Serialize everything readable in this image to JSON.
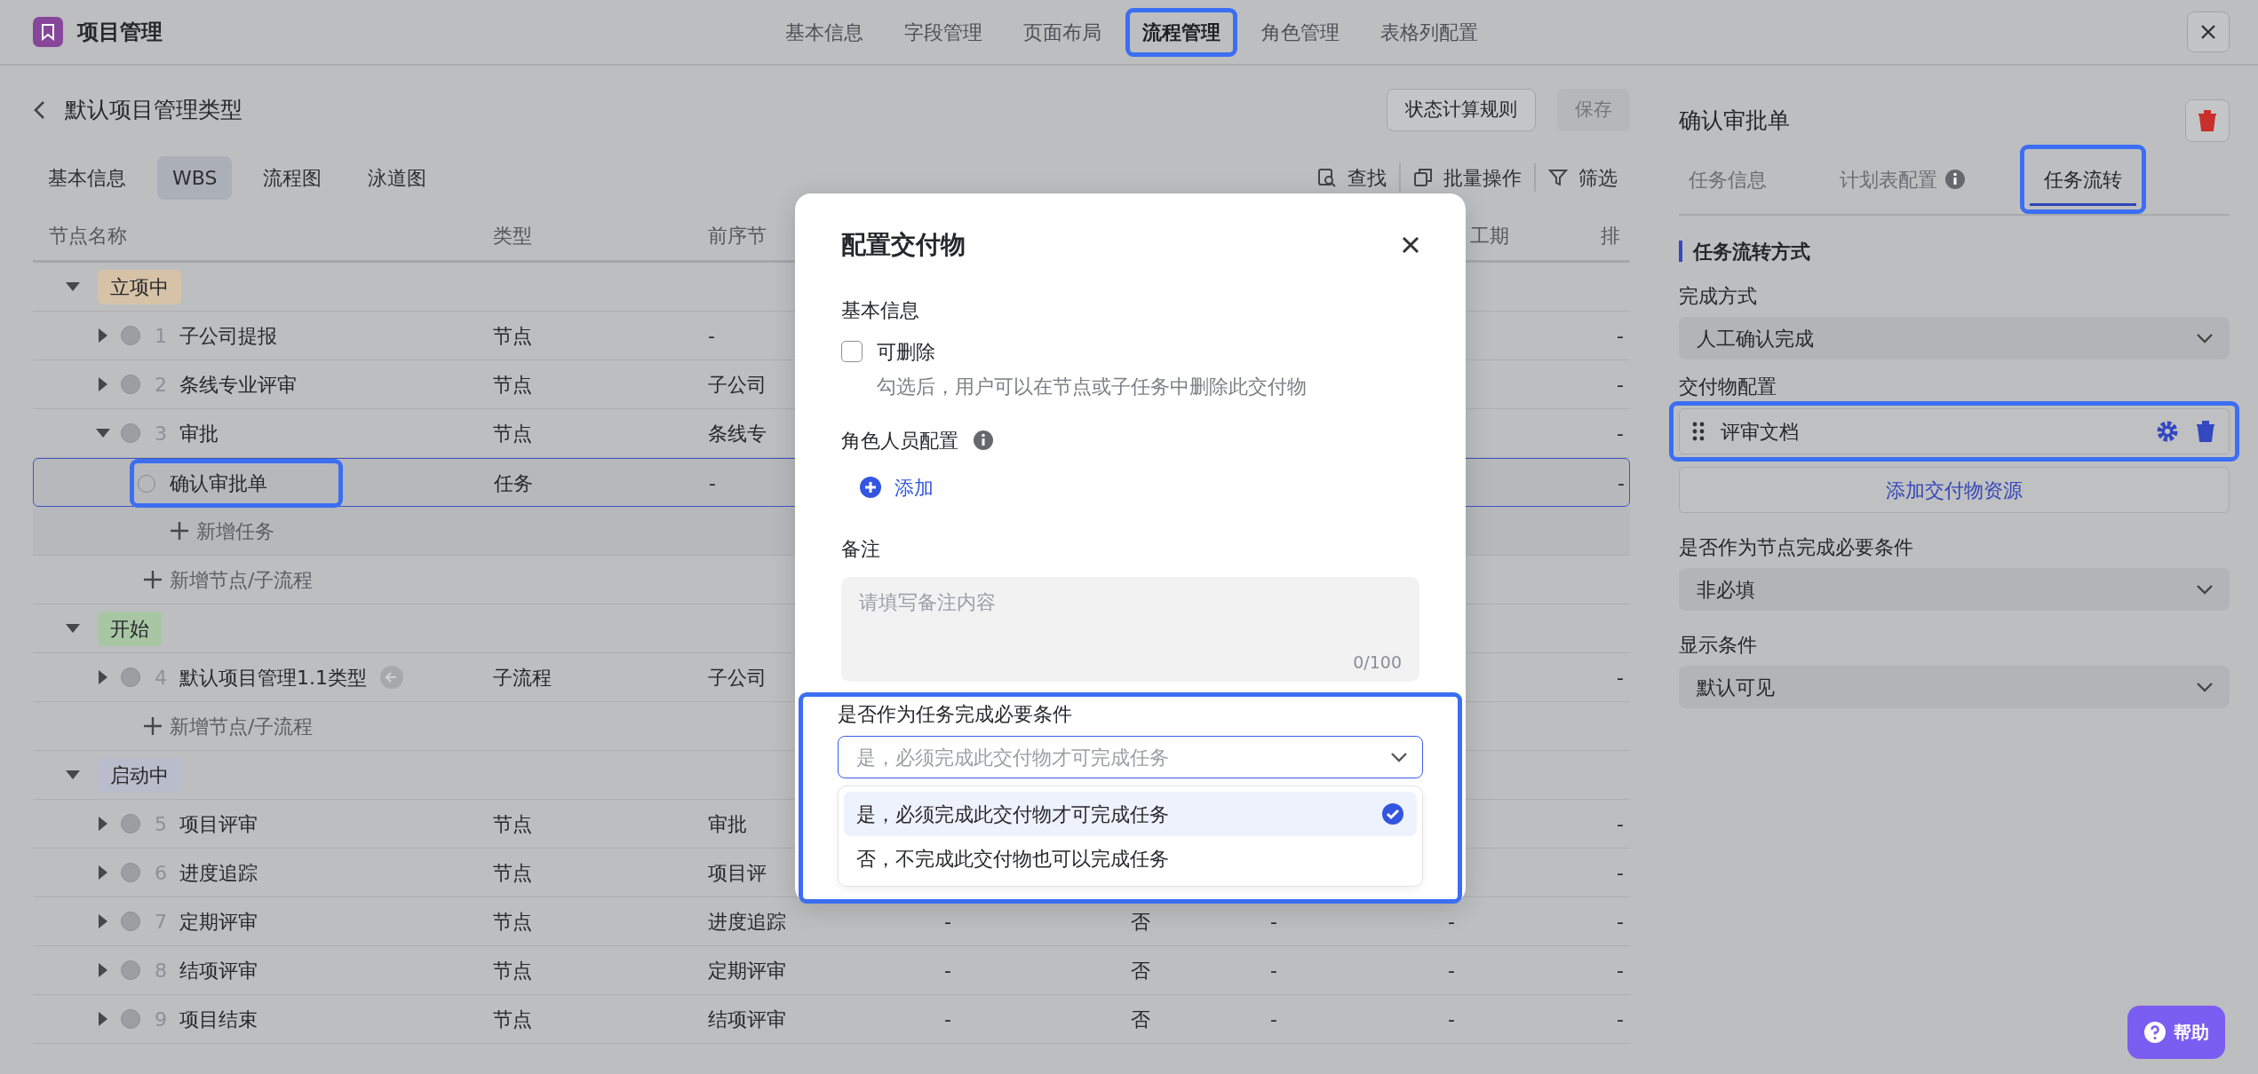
{
  "app": {
    "title": "项目管理"
  },
  "top_tabs": [
    {
      "label": "基本信息",
      "selected": false,
      "highlighted": false
    },
    {
      "label": "字段管理",
      "selected": false,
      "highlighted": false
    },
    {
      "label": "页面布局",
      "selected": false,
      "highlighted": false
    },
    {
      "label": "流程管理",
      "selected": true,
      "highlighted": true
    },
    {
      "label": "角色管理",
      "selected": false,
      "highlighted": false
    },
    {
      "label": "表格列配置",
      "selected": false,
      "highlighted": false
    }
  ],
  "page": {
    "title": "默认项目管理类型",
    "buttons": [
      {
        "label": "状态计算规则",
        "disabled": false
      },
      {
        "label": "保存",
        "disabled": true
      }
    ]
  },
  "view_tabs": [
    {
      "label": "基本信息",
      "selected": false
    },
    {
      "label": "WBS",
      "selected": true
    },
    {
      "label": "流程图",
      "selected": false
    },
    {
      "label": "泳道图",
      "selected": false
    }
  ],
  "toolbar": [
    {
      "kind": "search",
      "label": "查找"
    },
    {
      "kind": "batch",
      "label": "批量操作"
    },
    {
      "kind": "filter",
      "label": "筛选"
    }
  ],
  "table": {
    "columns": {
      "name": "节点名称",
      "type": "类型",
      "predecessor": "前序节",
      "column_7": "工期",
      "column_8": "排"
    },
    "groups": [
      {
        "label": "立项中",
        "color": "#d6c3a7",
        "expanded": true,
        "add_label": "新增节点/子流程",
        "rows": [
          {
            "kind": "node",
            "number": "1",
            "name": "子公司提报",
            "expanded": false,
            "selected": false,
            "type": "节点",
            "predecessor": "-",
            "column_8": "-"
          },
          {
            "kind": "node",
            "number": "2",
            "name": "条线专业评审",
            "expanded": false,
            "selected": false,
            "type": "节点",
            "predecessor": "子公司",
            "column_8": "-"
          },
          {
            "kind": "node",
            "number": "3",
            "name": "审批",
            "expanded": true,
            "selected": false,
            "type": "节点",
            "predecessor": "条线专",
            "column_8": "-",
            "add_label": "新增任务",
            "children": [
              {
                "kind": "task",
                "name": "确认审批单",
                "selected": true,
                "highlighted": true,
                "type": "任务",
                "predecessor": "-",
                "column_8": "-"
              }
            ]
          }
        ]
      },
      {
        "label": "开始",
        "color": "#a8c6a4",
        "expanded": true,
        "add_label": "新增节点/子流程",
        "rows": [
          {
            "kind": "subflow",
            "number": "4",
            "name": "默认项目管理1.1类型",
            "expanded": false,
            "selected": false,
            "type": "子流程",
            "predecessor": "子公司",
            "column_8": "-"
          }
        ]
      },
      {
        "label": "启动中",
        "color": "#b8bccb",
        "expanded": true,
        "rows": [
          {
            "kind": "node",
            "number": "5",
            "name": "项目评审",
            "expanded": false,
            "selected": false,
            "type": "节点",
            "predecessor": "审批",
            "column_8": "-"
          },
          {
            "kind": "node",
            "number": "6",
            "name": "进度追踪",
            "expanded": false,
            "selected": false,
            "type": "节点",
            "predecessor": "项目评",
            "column_8": "-"
          },
          {
            "kind": "node",
            "number": "7",
            "name": "定期评审",
            "expanded": false,
            "selected": false,
            "type": "节点",
            "predecessor": "进度追踪",
            "column_4": "-",
            "column_5": "否",
            "column_6": "-",
            "column_7": "-",
            "column_8": "-"
          },
          {
            "kind": "node",
            "number": "8",
            "name": "结项评审",
            "expanded": false,
            "selected": false,
            "type": "节点",
            "predecessor": "定期评审",
            "column_4": "-",
            "column_5": "否",
            "column_6": "-",
            "column_7": "-",
            "column_8": "-"
          },
          {
            "kind": "node",
            "number": "9",
            "name": "项目结束",
            "expanded": false,
            "selected": false,
            "type": "节点",
            "predecessor": "结项评审",
            "column_4": "-",
            "column_5": "否",
            "column_6": "-",
            "column_7": "-",
            "column_8": "-"
          }
        ]
      }
    ]
  },
  "detail": {
    "title": "确认审批单",
    "tabs": [
      {
        "label": "任务信息",
        "selected": false,
        "info": false,
        "highlighted": false
      },
      {
        "label": "计划表配置",
        "selected": false,
        "info": true,
        "highlighted": false
      },
      {
        "label": "任务流转",
        "selected": true,
        "info": false,
        "highlighted": true
      }
    ],
    "section_title": "任务流转方式",
    "fields": [
      {
        "kind": "select",
        "label": "完成方式",
        "value": "人工确认完成"
      },
      {
        "kind": "deliverables",
        "label": "交付物配置",
        "items": [
          {
            "name": "评审文档",
            "highlighted": true
          }
        ],
        "add_button": "添加交付物资源"
      },
      {
        "kind": "select",
        "label": "是否作为节点完成必要条件",
        "value": "非必填"
      },
      {
        "kind": "select",
        "label": "显示条件",
        "value": "默认可见"
      }
    ]
  },
  "dialog": {
    "title": "配置交付物",
    "basic_title": "基本信息",
    "checkbox": {
      "label": "可删除",
      "checked": false,
      "hint": "勾选后，用户可以在节点或子任务中删除此交付物"
    },
    "roles_title": "角色人员配置",
    "add_link": "添加",
    "note_title": "备注",
    "note": {
      "placeholder": "请填写备注内容",
      "counter": "0/100"
    },
    "required": {
      "label": "是否作为任务完成必要条件",
      "placeholder": "是，必须完成此交付物才可完成任务",
      "open": true,
      "highlighted": true,
      "options": [
        {
          "label": "是，必须完成此交付物才可完成任务",
          "selected": true
        },
        {
          "label": "否，不完成此交付物也可以完成任务",
          "selected": false
        }
      ]
    }
  },
  "help_button": "帮助"
}
